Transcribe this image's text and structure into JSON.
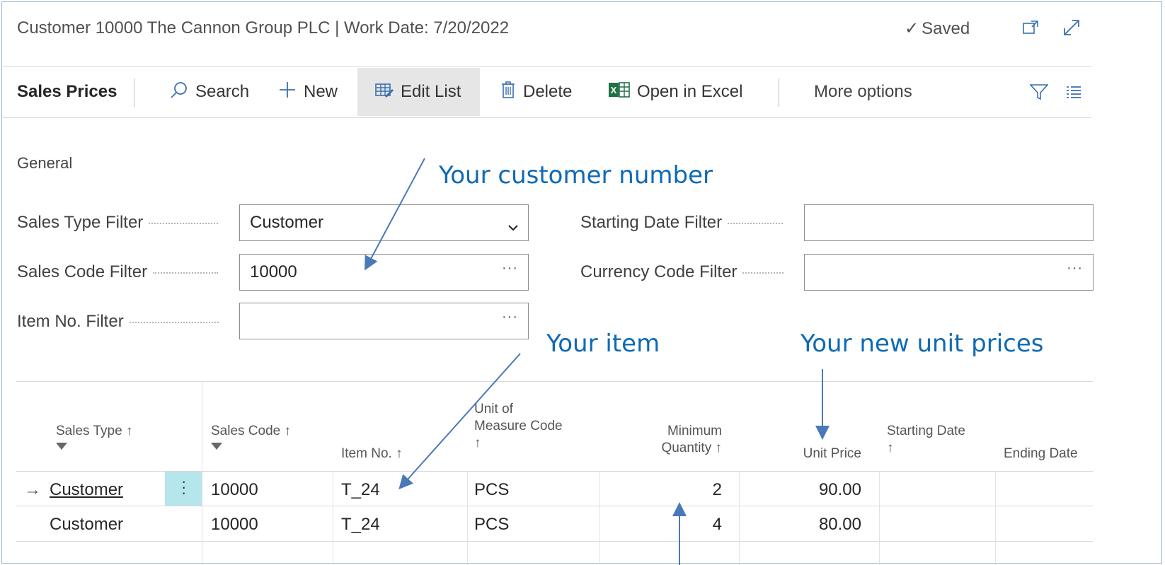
{
  "header": {
    "title": "Customer 10000 The Cannon Group PLC | Work Date: 7/20/2022",
    "saved_label": "Saved"
  },
  "toolbar": {
    "page_name": "Sales Prices",
    "search_label": "Search",
    "new_label": "New",
    "edit_list_label": "Edit List",
    "delete_label": "Delete",
    "excel_label": "Open in Excel",
    "more_label": "More options"
  },
  "general": {
    "heading": "General",
    "sales_type_filter": {
      "label": "Sales Type Filter",
      "value": "Customer"
    },
    "sales_code_filter": {
      "label": "Sales Code Filter",
      "value": "10000"
    },
    "item_no_filter": {
      "label": "Item No. Filter",
      "value": ""
    },
    "starting_date_filter": {
      "label": "Starting Date Filter",
      "value": ""
    },
    "currency_code_filter": {
      "label": "Currency Code Filter",
      "value": ""
    }
  },
  "annotations": {
    "customer_number": "Your customer number",
    "item": "Your item",
    "unit_prices": "Your new unit prices"
  },
  "grid": {
    "headers": {
      "sales_type": "Sales Type ↑",
      "sales_code": "Sales Code ↑",
      "item_no": "Item No. ↑",
      "uom_line1": "Unit of",
      "uom_line2": "Measure Code",
      "uom_line3": "↑",
      "minqty_line1": "Minimum",
      "minqty_line2": "Quantity ↑",
      "unit_price": "Unit Price",
      "start_line1": "Starting Date",
      "start_line2": "↑",
      "ending_date": "Ending Date"
    },
    "rows": [
      {
        "indicator": "→",
        "sales_type": "Customer",
        "sales_code": "10000",
        "item_no": "T_24",
        "uom": "PCS",
        "min_qty": "2",
        "unit_price": "90.00",
        "starting_date": "",
        "ending_date": ""
      },
      {
        "indicator": "",
        "sales_type": "Customer",
        "sales_code": "10000",
        "item_no": "T_24",
        "uom": "PCS",
        "min_qty": "4",
        "unit_price": "80.00",
        "starting_date": "",
        "ending_date": ""
      }
    ]
  },
  "colors": {
    "accent": "#0f6ab4",
    "callout": "#0f6ab4",
    "row_action": "#b5e6ec"
  }
}
